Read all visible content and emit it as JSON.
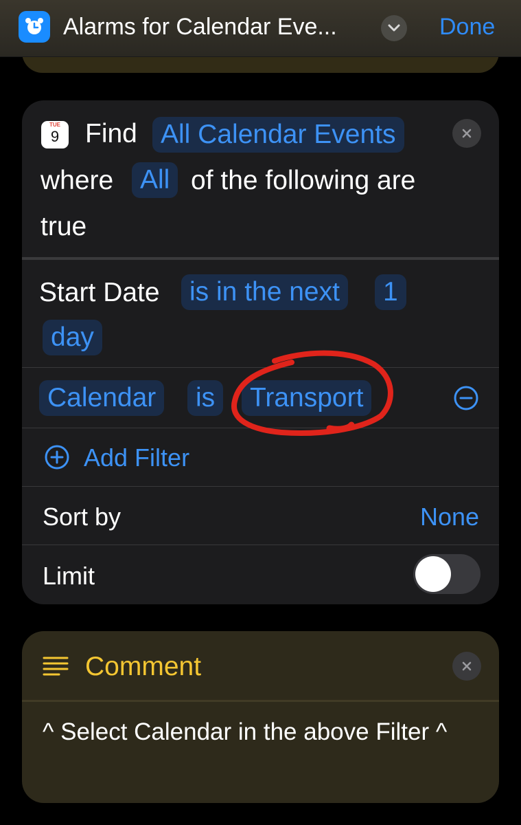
{
  "header": {
    "title": "Alarms for Calendar Eve...",
    "done_label": "Done",
    "app_icon": "alarm-clock-icon"
  },
  "find": {
    "calendar_icon_day": "TUE",
    "calendar_icon_date": "9",
    "find_label": "Find",
    "subject": "All Calendar Events",
    "where_label": "where",
    "match_mode": "All",
    "following_label": "of the following are",
    "true_label": "true",
    "filters": [
      {
        "property": "Start Date",
        "operator": "is in the next",
        "value": "1",
        "unit": "day"
      },
      {
        "property": "Calendar",
        "operator": "is",
        "value": "Transport"
      }
    ],
    "add_filter_label": "Add Filter",
    "sort_by_label": "Sort by",
    "sort_by_value": "None",
    "limit_label": "Limit",
    "limit_enabled": false
  },
  "comment": {
    "title": "Comment",
    "text": "^ Select Calendar in the above Filter ^"
  },
  "annotation_color": "#e0241b",
  "accent_color": "#3d92f5",
  "comment_color": "#f4c632"
}
